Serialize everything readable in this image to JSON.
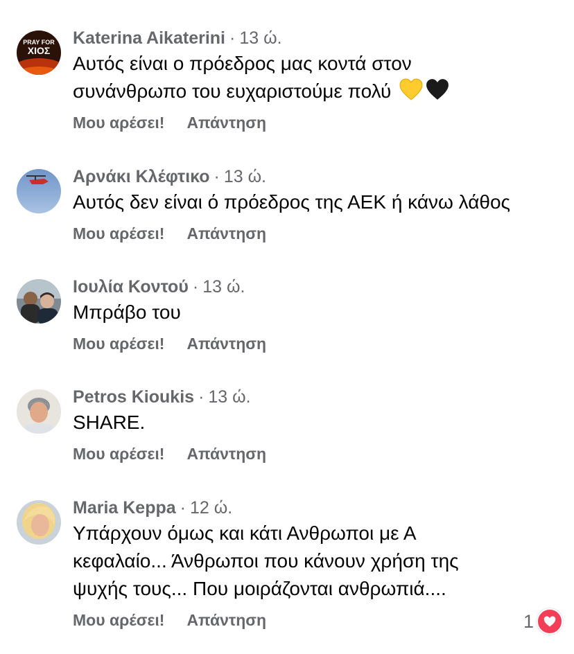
{
  "comments": [
    {
      "author": "Katerina Aikaterini",
      "time": "13 ώ.",
      "text_lines": [
        "Αυτός είναι ο πρόεδρος μας κοντά στον",
        "συνάνθρωπο του ευχαριστούμε πολύ"
      ],
      "avatar_text": [
        "PRAY FOR",
        "ΧΙΟΣ"
      ],
      "emojis": [
        "yellow-heart",
        "black-heart"
      ]
    },
    {
      "author": "Αρνάκι Κλέφτικο",
      "time": "13 ώ.",
      "text_lines": [
        "Αυτός δεν είναι ό πρόεδρος της ΑΕΚ ή κάνω λάθος"
      ]
    },
    {
      "author": "Ιουλία Κοντού",
      "time": "13 ώ.",
      "text_lines": [
        "Μπράβο του"
      ]
    },
    {
      "author": "Petros Kioukis",
      "time": "13 ώ.",
      "text_lines": [
        "SHARE."
      ]
    },
    {
      "author": "Maria Keppa",
      "time": "12 ώ.",
      "text_lines": [
        "Υπάρχουν όμως και κάτι Ανθρωποι με Α",
        "κεφαλαίο... Άνθρωποι που κάνουν χρήση της",
        "ψυχής τους... Που μοιράζονται ανθρωπιά...."
      ],
      "reaction_count": "1",
      "reaction_icon": "heart-icon"
    }
  ],
  "actions": {
    "like_label": "Μου αρέσει!",
    "reply_label": "Απάντηση"
  },
  "meta_separator": "·",
  "colors": {
    "secondary_text": "#65676b",
    "primary_text": "#050505",
    "love_reaction": "#f33e58"
  }
}
